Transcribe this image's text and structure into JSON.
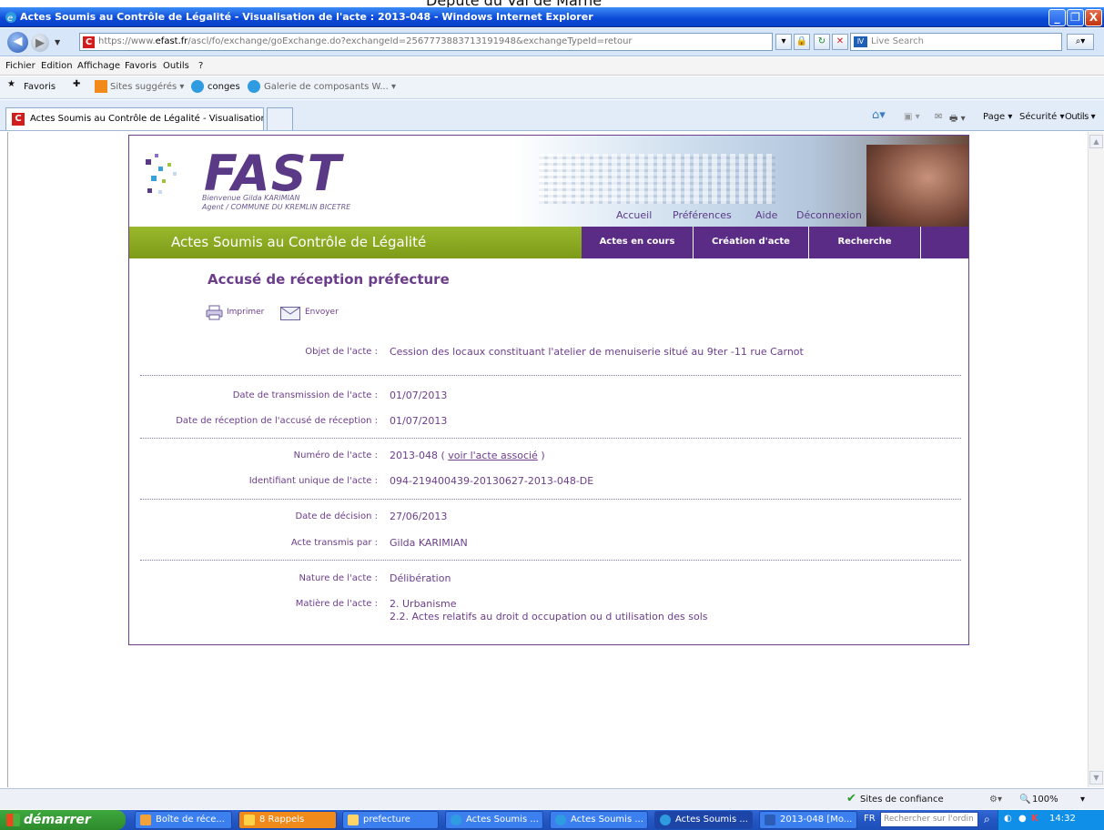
{
  "window": {
    "top_cropped_text": "Député du Val de Marne",
    "title": "Actes Soumis au Contrôle de Légalité - Visualisation de l'acte : 2013-048 - Windows Internet Explorer",
    "minimize": "_",
    "maximize": "❐",
    "close": "X"
  },
  "address_bar": {
    "url_prefix": "https://www.",
    "url_domain": "efast.fr",
    "url_rest": "/ascl/fo/exchange/goExchange.do?exchangeId=2567773883713191948&exchangeTypeId=retour",
    "search_placeholder": "Live Search"
  },
  "menu": [
    "Fichier",
    "Edition",
    "Affichage",
    "Favoris",
    "Outils",
    "?"
  ],
  "favorites_bar": {
    "favorites": "Favoris",
    "items": [
      "Sites suggérés ▾",
      "conges",
      "Galerie de composants W... ▾"
    ]
  },
  "tab": {
    "title": "Actes Soumis au Contrôle de Légalité - Visualisation d...",
    "commands": [
      "Page ▾",
      "Sécurité ▾",
      "Outils ▾"
    ]
  },
  "fast": {
    "logo": "FAST",
    "welcome_line1": "Bienvenue Gilda KARIMIAN",
    "welcome_line2": "Agent / COMMUNE DU KREMLIN BICETRE",
    "top_nav": [
      "Accueil",
      "Préférences",
      "Aide",
      "Déconnexion"
    ],
    "section_title": "Actes Soumis au Contrôle de Légalité",
    "main_nav": [
      "Actes en cours",
      "Création d'acte",
      "Recherche"
    ],
    "page_heading": "Accusé de réception préfecture",
    "print": "Imprimer",
    "send": "Envoyer",
    "fields": {
      "objet_label": "Objet de l'acte :",
      "objet_value": "Cession des locaux constituant l'atelier de menuiserie situé au 9ter -11 rue Carnot",
      "date_transmission_label": "Date de transmission de l'acte :",
      "date_transmission_value": "01/07/2013",
      "date_reception_label": "Date de réception de l'accusé de réception :",
      "date_reception_value": "01/07/2013",
      "numero_label": "Numéro de l'acte :",
      "numero_value": "2013-048 (",
      "numero_link": "voir l'acte associé",
      "numero_close": ")",
      "identifiant_label": "Identifiant unique de l'acte :",
      "identifiant_value": "094-219400439-20130627-2013-048-DE",
      "date_decision_label": "Date de décision :",
      "date_decision_value": "27/06/2013",
      "transmis_label": "Acte transmis par :",
      "transmis_value": "Gilda KARIMIAN",
      "nature_label": "Nature de l'acte :",
      "nature_value": "Délibération",
      "matiere_label": "Matière de l'acte :",
      "matiere_value_1": "2. Urbanisme",
      "matiere_value_2": "2.2. Actes relatifs au droit d occupation ou d utilisation des sols"
    }
  },
  "status_bar": {
    "zone": "Sites de confiance",
    "zoom": "100%"
  },
  "taskbar": {
    "start": "démarrer",
    "tasks": [
      "Boîte de réce...",
      "8 Rappels",
      "prefecture",
      "Actes Soumis ...",
      "Actes Soumis ...",
      "Actes Soumis ...",
      "2013-048 [Mo..."
    ],
    "lang": "FR",
    "search_placeholder": "Rechercher sur l'ordin",
    "clock": "14:32"
  }
}
